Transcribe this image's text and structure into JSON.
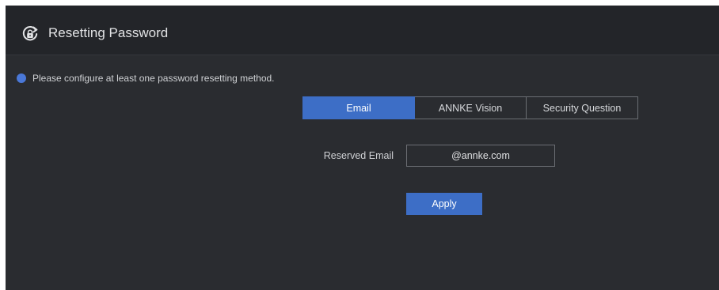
{
  "header": {
    "title": "Resetting Password",
    "icon": "lock-reset-icon"
  },
  "notice": {
    "text": "Please configure at least one password resetting method.",
    "dot_color": "#4a78d8"
  },
  "tabs": [
    {
      "label": "Email",
      "active": true
    },
    {
      "label": "ANNKE Vision",
      "active": false
    },
    {
      "label": "Security Question",
      "active": false
    }
  ],
  "form": {
    "reserved_email_label": "Reserved Email",
    "reserved_email_value": "@annke.com"
  },
  "actions": {
    "apply_label": "Apply"
  },
  "colors": {
    "accent": "#3d6ec6",
    "background": "#2a2c30",
    "header_background": "#232529"
  }
}
